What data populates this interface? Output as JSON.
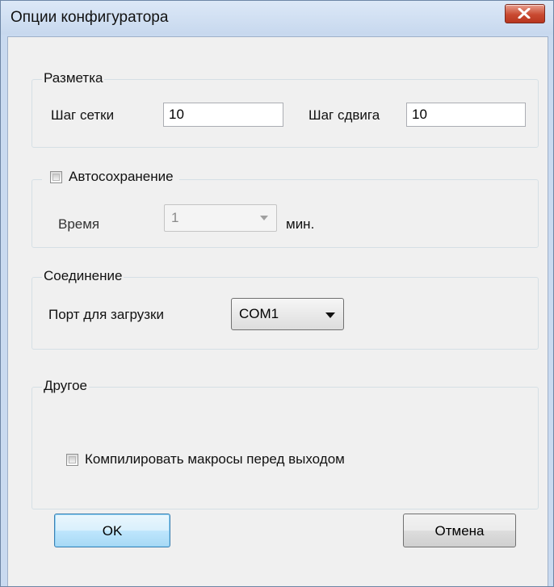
{
  "window": {
    "title": "Опции конфигуратора"
  },
  "layout_group": {
    "legend": "Разметка",
    "grid_step_label": "Шаг сетки",
    "grid_step_value": "10",
    "shift_step_label": "Шаг сдвига",
    "shift_step_value": "10"
  },
  "autosave_group": {
    "legend": "Автосохранение",
    "checked": false,
    "time_label": "Время",
    "time_value": "1",
    "unit_label": "мин."
  },
  "connection_group": {
    "legend": "Соединение",
    "port_label": "Порт для загрузки",
    "port_value": "COM1"
  },
  "other_group": {
    "legend": "Другое",
    "compile_label": "Компилировать макросы перед выходом",
    "compile_checked": false
  },
  "buttons": {
    "ok_label": "OK",
    "cancel_label": "Отмена"
  }
}
